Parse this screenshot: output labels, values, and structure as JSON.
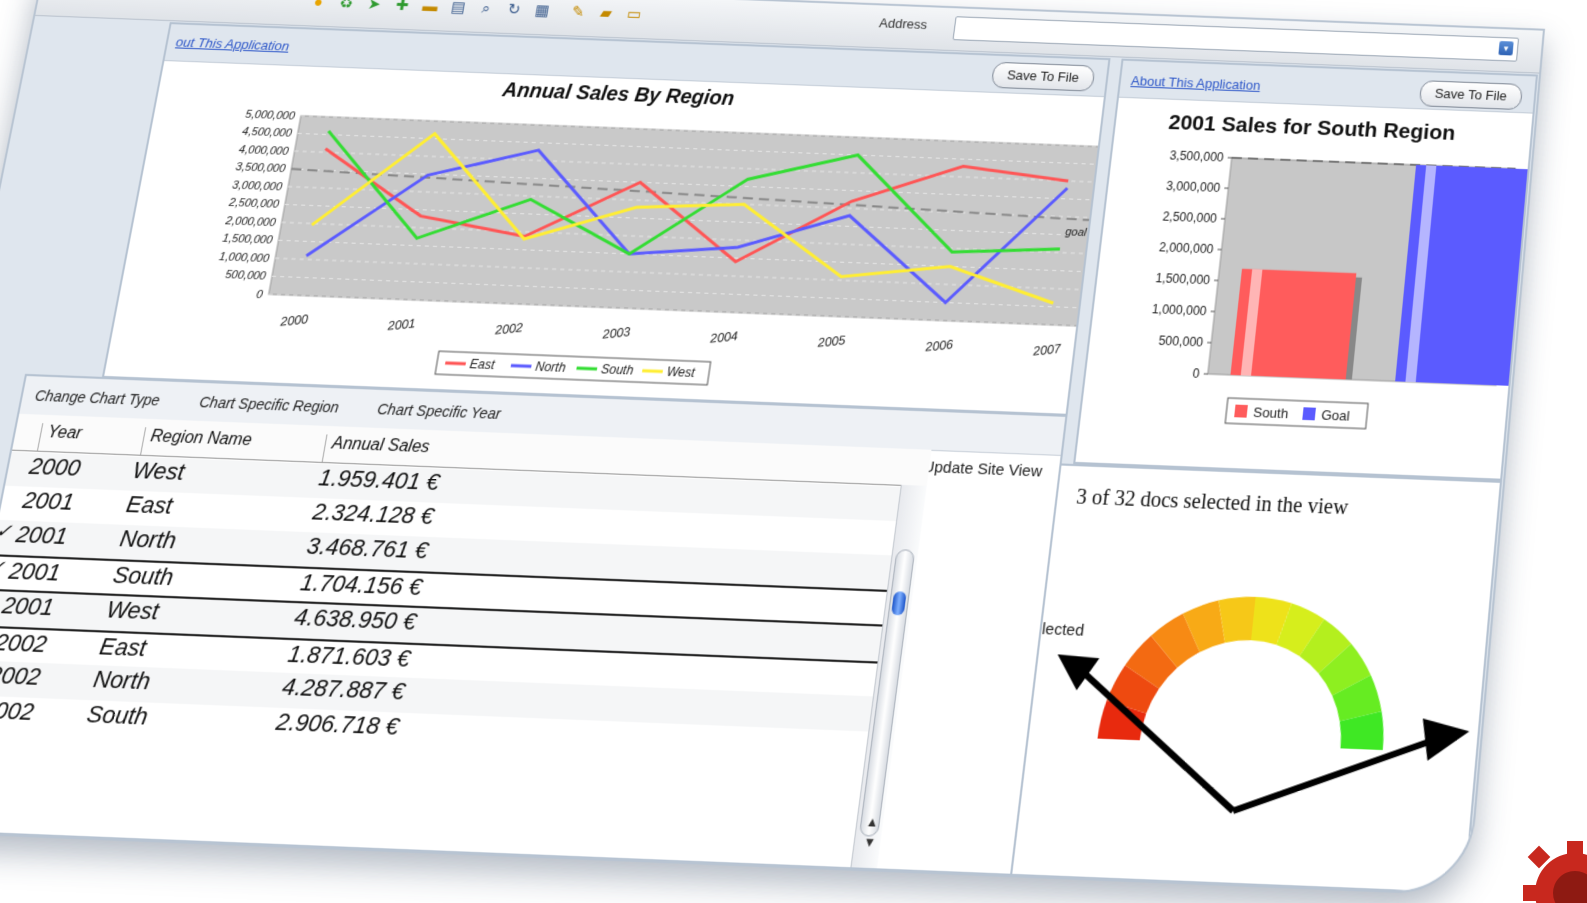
{
  "toolbar": {
    "address_label": "Address",
    "address_value": "",
    "icons": [
      "circle-yellow-icon",
      "recycle-icon",
      "arrow-icon",
      "plus-icon",
      "minus-icon",
      "print-icon",
      "binoculars-icon",
      "refresh-icon",
      "calendar-icon",
      "tools-icon",
      "folder-icon",
      "window-icon"
    ]
  },
  "left_chart_panel": {
    "about_link": "out This Application",
    "save_label": "Save To File",
    "chart_data": {
      "type": "line",
      "title": "Annual Sales By Region",
      "categories": [
        "2000",
        "2001",
        "2002",
        "2003",
        "2004",
        "2005",
        "2006",
        "2007"
      ],
      "y_ticks": [
        "5,000,000",
        "4,500,000",
        "4,000,000",
        "3,500,000",
        "3,000,000",
        "2,500,000",
        "2,000,000",
        "1,500,000",
        "1,000,000",
        "500,000",
        "0"
      ],
      "ylim": [
        0,
        5000000
      ],
      "goal": 3500000,
      "goal_label": "goal",
      "series": [
        {
          "name": "East",
          "color": "#ff5555",
          "values": [
            4100000,
            2324128,
            1871603,
            3500000,
            1400000,
            3200000,
            4300000,
            4000000
          ]
        },
        {
          "name": "North",
          "color": "#5b5bff",
          "values": [
            1100000,
            3468761,
            4287887,
            1500000,
            1800000,
            2800000,
            500000,
            3800000
          ]
        },
        {
          "name": "South",
          "color": "#33dd33",
          "values": [
            4600000,
            1704156,
            2906718,
            1500000,
            3700000,
            4500000,
            1900000,
            2100000
          ]
        },
        {
          "name": "West",
          "color": "#ffee33",
          "values": [
            1959401,
            4638950,
            1800000,
            2800000,
            3000000,
            1100000,
            1500000,
            600000
          ]
        }
      ],
      "legend_position": "bottom"
    }
  },
  "right_chart_panel": {
    "about_link": "About This Application",
    "save_label": "Save To File",
    "chart_data": {
      "type": "bar",
      "title": "2001 Sales for South Region",
      "categories": [
        "South",
        "Goal"
      ],
      "values": [
        1704156,
        3500000
      ],
      "colors": [
        "#ff5c5c",
        "#5b5bff"
      ],
      "y_ticks": [
        "3,500,000",
        "3,000,000",
        "2,500,000",
        "2,000,000",
        "1,500,000",
        "1,000,000",
        "500,000",
        "0"
      ],
      "ylim": [
        0,
        3500000
      ],
      "legend": [
        "South",
        "Goal"
      ]
    }
  },
  "grid_panel": {
    "tabs": [
      "Change Chart Type",
      "Chart Specific Region",
      "Chart Specific Year"
    ],
    "action_label": "Go To Update Site View",
    "columns": [
      "Year",
      "Region Name",
      "Annual Sales"
    ],
    "rows": [
      {
        "check": "",
        "year": "2000",
        "region": "West",
        "sales": "1.959.401 €"
      },
      {
        "check": "",
        "year": "2001",
        "region": "East",
        "sales": "2.324.128 €"
      },
      {
        "check": "✓",
        "year": "2001",
        "region": "North",
        "sales": "3.468.761 €"
      },
      {
        "check": "✓",
        "year": "2001",
        "region": "South",
        "sales": "1.704.156 €"
      },
      {
        "check": "",
        "year": "2001",
        "region": "West",
        "sales": "4.638.950 €"
      },
      {
        "check": "✓",
        "year": "2002",
        "region": "East",
        "sales": "1.871.603 €"
      },
      {
        "check": "",
        "year": "2002",
        "region": "North",
        "sales": "4.287.887 €"
      },
      {
        "check": "",
        "year": "2002",
        "region": "South",
        "sales": "2.906.718 €"
      }
    ]
  },
  "gauge_panel": {
    "status_text": "3 of 32 docs selected in the view",
    "gauge_label": "Selected",
    "selected_fraction": 0.09
  }
}
